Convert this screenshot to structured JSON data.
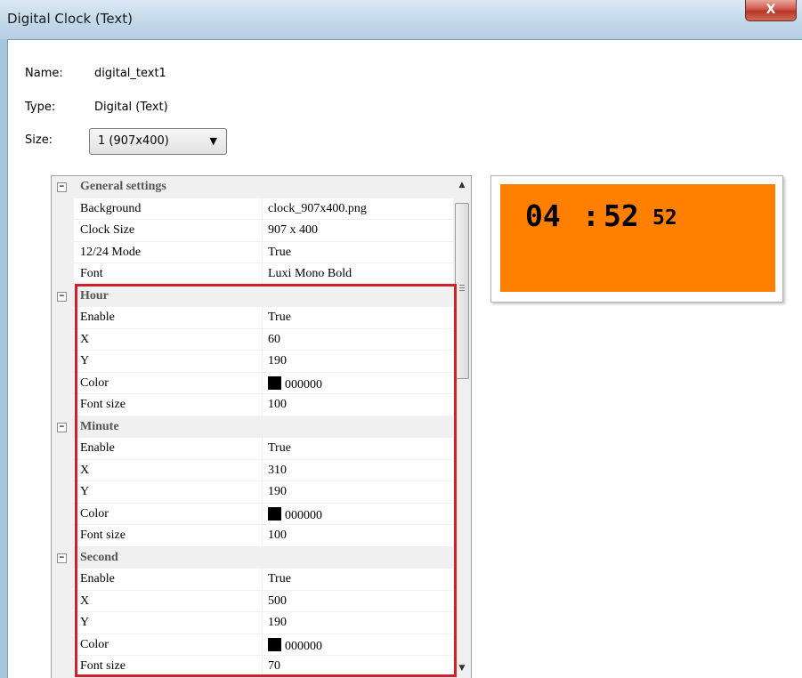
{
  "window": {
    "title": "Digital Clock (Text)",
    "close_label": "X"
  },
  "info": {
    "name_label": "Name:",
    "name_value": "digital_text1",
    "type_label": "Type:",
    "type_value": "Digital (Text)",
    "size_label": "Size:",
    "size_value": "1  (907x400)"
  },
  "grid": {
    "rows": [
      {
        "kind": "cat",
        "name": "General settings",
        "toggle": "−"
      },
      {
        "kind": "prop",
        "name": "Background",
        "value": "clock_907x400.png"
      },
      {
        "kind": "prop",
        "name": "Clock Size",
        "value": "907 x 400"
      },
      {
        "kind": "prop",
        "name": "12/24 Mode",
        "value": "True"
      },
      {
        "kind": "prop",
        "name": "Font",
        "value": "Luxi Mono Bold"
      },
      {
        "kind": "cat",
        "name": "Hour",
        "toggle": "−"
      },
      {
        "kind": "prop",
        "name": "Enable",
        "value": "True"
      },
      {
        "kind": "prop",
        "name": "X",
        "value": "60"
      },
      {
        "kind": "prop",
        "name": "Y",
        "value": "190"
      },
      {
        "kind": "prop",
        "name": "Color",
        "value": "000000",
        "swatch": "#000000"
      },
      {
        "kind": "prop",
        "name": "Font size",
        "value": "100"
      },
      {
        "kind": "cat",
        "name": "Minute",
        "toggle": "−"
      },
      {
        "kind": "prop",
        "name": "Enable",
        "value": "True"
      },
      {
        "kind": "prop",
        "name": "X",
        "value": "310"
      },
      {
        "kind": "prop",
        "name": "Y",
        "value": "190"
      },
      {
        "kind": "prop",
        "name": "Color",
        "value": "000000",
        "swatch": "#000000"
      },
      {
        "kind": "prop",
        "name": "Font size",
        "value": "100"
      },
      {
        "kind": "cat",
        "name": "Second",
        "toggle": "−"
      },
      {
        "kind": "prop",
        "name": "Enable",
        "value": "True"
      },
      {
        "kind": "prop",
        "name": "X",
        "value": "500"
      },
      {
        "kind": "prop",
        "name": "Y",
        "value": "190"
      },
      {
        "kind": "prop",
        "name": "Color",
        "value": "000000",
        "swatch": "#000000"
      },
      {
        "kind": "prop",
        "name": "Font size",
        "value": "70"
      }
    ],
    "scroll_up_icon": "▲",
    "scroll_down_icon": "▼"
  },
  "preview": {
    "hour": "04",
    "colon": ":",
    "minute": "52",
    "second": "52",
    "background_color": "#ff8000",
    "text_color": "#000000"
  },
  "colors": {
    "highlight": "#d0202a",
    "accent_window": "#b5cfe3"
  }
}
